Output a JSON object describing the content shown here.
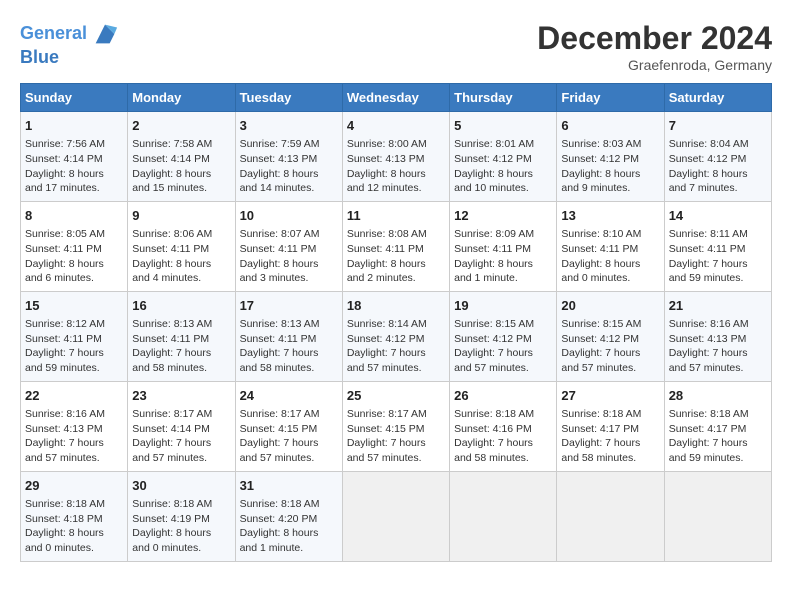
{
  "header": {
    "logo_line1": "General",
    "logo_line2": "Blue",
    "month": "December 2024",
    "location": "Graefenroda, Germany"
  },
  "weekdays": [
    "Sunday",
    "Monday",
    "Tuesday",
    "Wednesday",
    "Thursday",
    "Friday",
    "Saturday"
  ],
  "weeks": [
    [
      {
        "day": "1",
        "sunrise": "7:56 AM",
        "sunset": "4:14 PM",
        "daylight": "8 hours and 17 minutes."
      },
      {
        "day": "2",
        "sunrise": "7:58 AM",
        "sunset": "4:14 PM",
        "daylight": "8 hours and 15 minutes."
      },
      {
        "day": "3",
        "sunrise": "7:59 AM",
        "sunset": "4:13 PM",
        "daylight": "8 hours and 14 minutes."
      },
      {
        "day": "4",
        "sunrise": "8:00 AM",
        "sunset": "4:13 PM",
        "daylight": "8 hours and 12 minutes."
      },
      {
        "day": "5",
        "sunrise": "8:01 AM",
        "sunset": "4:12 PM",
        "daylight": "8 hours and 10 minutes."
      },
      {
        "day": "6",
        "sunrise": "8:03 AM",
        "sunset": "4:12 PM",
        "daylight": "8 hours and 9 minutes."
      },
      {
        "day": "7",
        "sunrise": "8:04 AM",
        "sunset": "4:12 PM",
        "daylight": "8 hours and 7 minutes."
      }
    ],
    [
      {
        "day": "8",
        "sunrise": "8:05 AM",
        "sunset": "4:11 PM",
        "daylight": "8 hours and 6 minutes."
      },
      {
        "day": "9",
        "sunrise": "8:06 AM",
        "sunset": "4:11 PM",
        "daylight": "8 hours and 4 minutes."
      },
      {
        "day": "10",
        "sunrise": "8:07 AM",
        "sunset": "4:11 PM",
        "daylight": "8 hours and 3 minutes."
      },
      {
        "day": "11",
        "sunrise": "8:08 AM",
        "sunset": "4:11 PM",
        "daylight": "8 hours and 2 minutes."
      },
      {
        "day": "12",
        "sunrise": "8:09 AM",
        "sunset": "4:11 PM",
        "daylight": "8 hours and 1 minute."
      },
      {
        "day": "13",
        "sunrise": "8:10 AM",
        "sunset": "4:11 PM",
        "daylight": "8 hours and 0 minutes."
      },
      {
        "day": "14",
        "sunrise": "8:11 AM",
        "sunset": "4:11 PM",
        "daylight": "7 hours and 59 minutes."
      }
    ],
    [
      {
        "day": "15",
        "sunrise": "8:12 AM",
        "sunset": "4:11 PM",
        "daylight": "7 hours and 59 minutes."
      },
      {
        "day": "16",
        "sunrise": "8:13 AM",
        "sunset": "4:11 PM",
        "daylight": "7 hours and 58 minutes."
      },
      {
        "day": "17",
        "sunrise": "8:13 AM",
        "sunset": "4:11 PM",
        "daylight": "7 hours and 58 minutes."
      },
      {
        "day": "18",
        "sunrise": "8:14 AM",
        "sunset": "4:12 PM",
        "daylight": "7 hours and 57 minutes."
      },
      {
        "day": "19",
        "sunrise": "8:15 AM",
        "sunset": "4:12 PM",
        "daylight": "7 hours and 57 minutes."
      },
      {
        "day": "20",
        "sunrise": "8:15 AM",
        "sunset": "4:12 PM",
        "daylight": "7 hours and 57 minutes."
      },
      {
        "day": "21",
        "sunrise": "8:16 AM",
        "sunset": "4:13 PM",
        "daylight": "7 hours and 57 minutes."
      }
    ],
    [
      {
        "day": "22",
        "sunrise": "8:16 AM",
        "sunset": "4:13 PM",
        "daylight": "7 hours and 57 minutes."
      },
      {
        "day": "23",
        "sunrise": "8:17 AM",
        "sunset": "4:14 PM",
        "daylight": "7 hours and 57 minutes."
      },
      {
        "day": "24",
        "sunrise": "8:17 AM",
        "sunset": "4:15 PM",
        "daylight": "7 hours and 57 minutes."
      },
      {
        "day": "25",
        "sunrise": "8:17 AM",
        "sunset": "4:15 PM",
        "daylight": "7 hours and 57 minutes."
      },
      {
        "day": "26",
        "sunrise": "8:18 AM",
        "sunset": "4:16 PM",
        "daylight": "7 hours and 58 minutes."
      },
      {
        "day": "27",
        "sunrise": "8:18 AM",
        "sunset": "4:17 PM",
        "daylight": "7 hours and 58 minutes."
      },
      {
        "day": "28",
        "sunrise": "8:18 AM",
        "sunset": "4:17 PM",
        "daylight": "7 hours and 59 minutes."
      }
    ],
    [
      {
        "day": "29",
        "sunrise": "8:18 AM",
        "sunset": "4:18 PM",
        "daylight": "8 hours and 0 minutes."
      },
      {
        "day": "30",
        "sunrise": "8:18 AM",
        "sunset": "4:19 PM",
        "daylight": "8 hours and 0 minutes."
      },
      {
        "day": "31",
        "sunrise": "8:18 AM",
        "sunset": "4:20 PM",
        "daylight": "8 hours and 1 minute."
      },
      null,
      null,
      null,
      null
    ]
  ]
}
